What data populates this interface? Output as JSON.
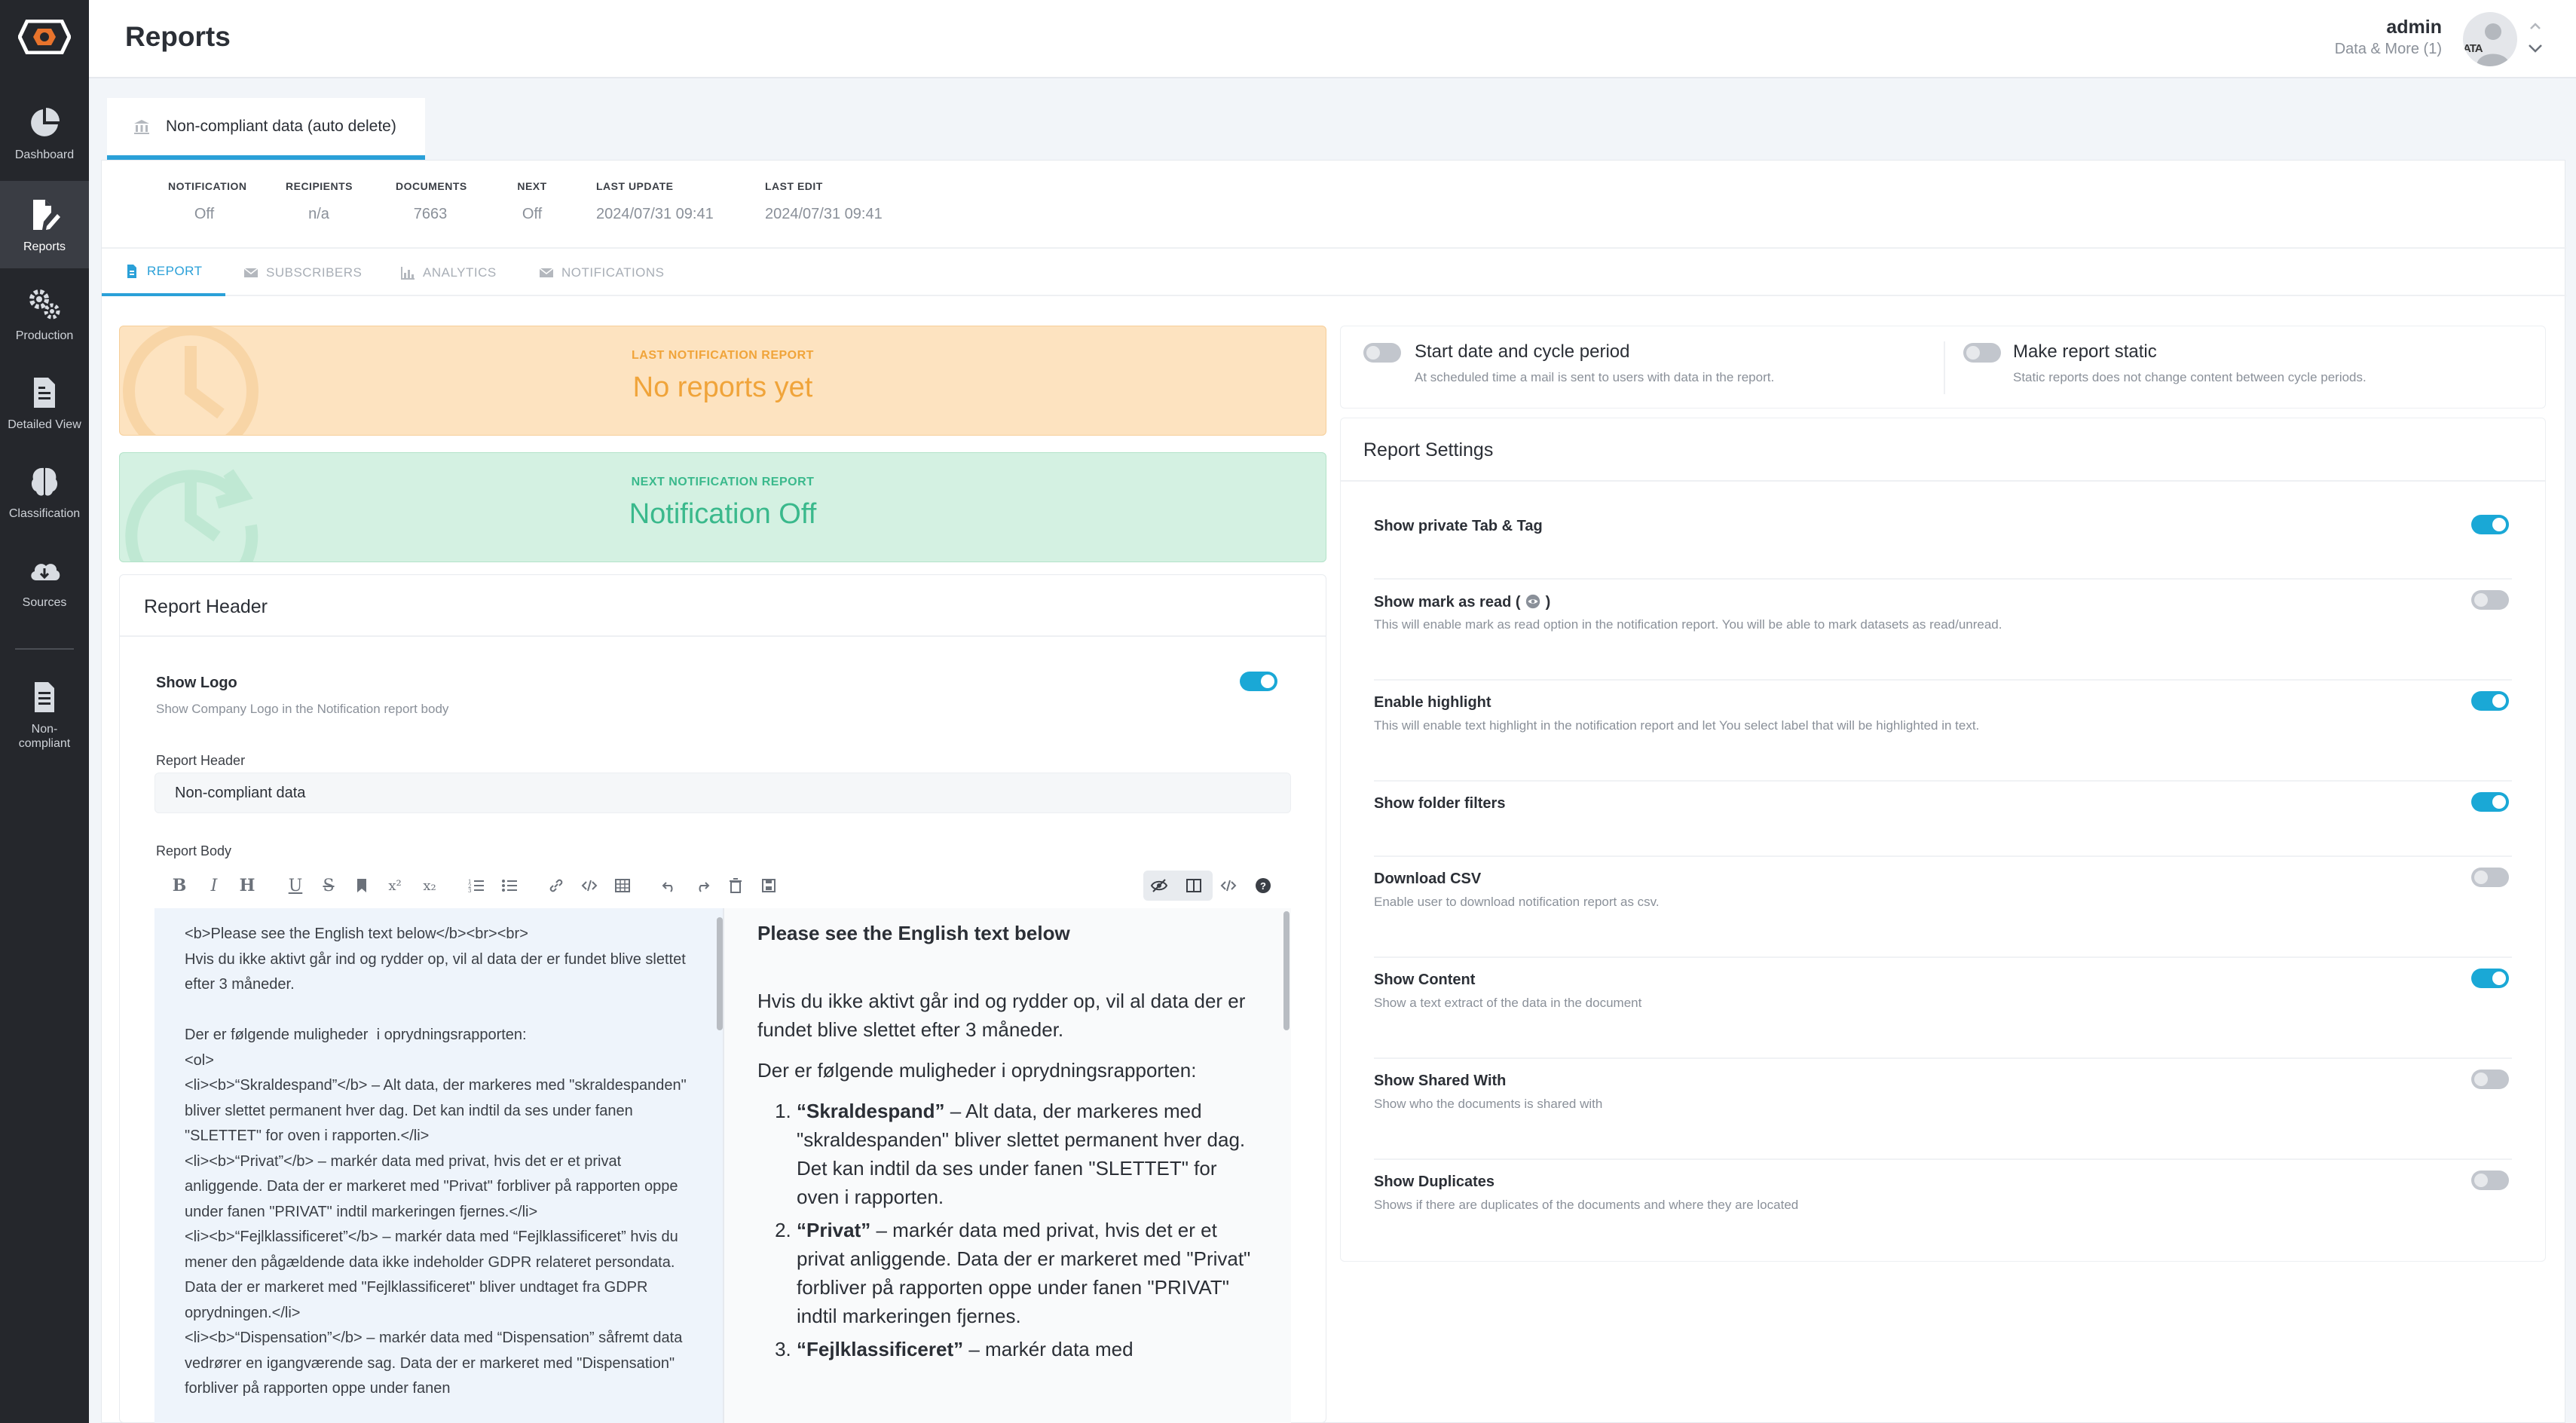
{
  "sidebar": {
    "items": [
      {
        "label": "Dashboard",
        "icon": "pie-chart-icon"
      },
      {
        "label": "Reports",
        "icon": "report-edit-icon"
      },
      {
        "label": "Production",
        "icon": "gears-icon"
      },
      {
        "label": "Detailed View",
        "icon": "document-icon"
      },
      {
        "label": "Classification",
        "icon": "brain-icon"
      },
      {
        "label": "Sources",
        "icon": "cloud-download-icon"
      },
      {
        "label": "Non-\ncompliant",
        "icon": "non-compliant-doc-icon"
      }
    ],
    "active": "Reports"
  },
  "header": {
    "title": "Reports",
    "user_name": "admin",
    "user_org": "Data & More (1)",
    "avatar_text": "ATA"
  },
  "report_tab": {
    "label": "Non-compliant data (auto delete)"
  },
  "stats": [
    {
      "label": "NOTIFICATION",
      "value": "Off"
    },
    {
      "label": "RECIPIENTS",
      "value": "n/a"
    },
    {
      "label": "DOCUMENTS",
      "value": "7663"
    },
    {
      "label": "NEXT",
      "value": "Off"
    },
    {
      "label": "LAST UPDATE",
      "value": "2024/07/31 09:41"
    },
    {
      "label": "LAST EDIT",
      "value": "2024/07/31 09:41"
    }
  ],
  "subtabs": [
    {
      "label": "REPORT",
      "active": true
    },
    {
      "label": "SUBSCRIBERS",
      "active": false
    },
    {
      "label": "ANALYTICS",
      "active": false
    },
    {
      "label": "NOTIFICATIONS",
      "active": false
    }
  ],
  "banners": {
    "last": {
      "label": "LAST NOTIFICATION REPORT",
      "value": "No reports yet"
    },
    "next": {
      "label": "NEXT NOTIFICATION REPORT",
      "value": "Notification Off"
    }
  },
  "report_header": {
    "title": "Report Header",
    "show_logo_label": "Show Logo",
    "show_logo_sub": "Show Company Logo in the Notification report body",
    "show_logo_on": true,
    "header_field_label": "Report Header",
    "header_value": "Non-compliant data",
    "body_field_label": "Report Body",
    "body_source": "<b>Please see the English text below</b><br><br>\nHvis du ikke aktivt går ind og rydder op, vil al data der er fundet blive slettet efter 3 måneder.\n\nDer er følgende muligheder  i oprydningsrapporten:\n<ol>\n<li><b>“Skraldespand”</b> – Alt data, der markeres med \"skraldespanden\" bliver slettet permanent hver dag. Det kan indtil da ses under fanen \"SLETTET\" for oven i rapporten.</li>\n<li><b>“Privat”</b> – markér data med privat, hvis det er et privat anliggende. Data der er markeret med \"Privat\" forbliver på rapporten oppe under fanen \"PRIVAT\" indtil markeringen fjernes.</li>\n<li><b>“Fejlklassificeret”</b> – markér data med “Fejlklassificeret” hvis du mener den pågældende data ikke indeholder GDPR relateret persondata. Data der er markeret med \"Fejlklassificeret\" bliver undtaget fra GDPR oprydningen.</li>\n<li><b>“Dispensation”</b> – markér data med “Dispensation” såfremt data vedrører en igangværende sag. Data der er markeret med \"Dispensation\" forbliver på rapporten oppe under fanen",
    "preview": {
      "heading": "Please see the English text below",
      "para1": "Hvis du ikke aktivt går ind og rydder op, vil al data der er fundet blive slettet efter 3 måneder.",
      "para2": "Der er følgende muligheder i oprydningsrapporten:",
      "items": [
        {
          "bold": "“Skraldespand”",
          "text": " – Alt data, der markeres med \"skraldespanden\" bliver slettet permanent hver dag. Det kan indtil da ses under fanen \"SLETTET\" for oven i rapporten."
        },
        {
          "bold": "“Privat”",
          "text": " – markér data med privat, hvis det er et privat anliggende. Data der er markeret med \"Privat\" forbliver på rapporten oppe under fanen \"PRIVAT\" indtil markeringen fjernes."
        },
        {
          "bold": "“Fejlklassificeret”",
          "text": " – markér data med"
        }
      ]
    }
  },
  "schedule": {
    "start_title": "Start date and cycle period",
    "start_sub": "At scheduled time a mail is sent to users with data in the report.",
    "start_on": false,
    "static_title": "Make report static",
    "static_sub": "Static reports does not change content between cycle periods.",
    "static_on": false
  },
  "report_settings": {
    "title": "Report Settings",
    "rows": [
      {
        "title": "Show private Tab & Tag",
        "sub": "",
        "on": true
      },
      {
        "title": "Show mark as read (",
        "title_suffix": " )",
        "sub": "This will enable mark as read option in the notification report. You will be able to mark datasets as read/unread.",
        "on": false
      },
      {
        "title": "Enable highlight",
        "sub": "This will enable text highlight in the notification report and let You select label that will be highlighted in text.",
        "on": true
      },
      {
        "title": "Show folder filters",
        "sub": "",
        "on": true
      },
      {
        "title": "Download CSV",
        "sub": "Enable user to download notification report as csv.",
        "on": false
      },
      {
        "title": "Show Content",
        "sub": "Show a text extract of the data in the document",
        "on": true
      },
      {
        "title": "Show Shared With",
        "sub": "Show who the documents is shared with",
        "on": false
      },
      {
        "title": "Show Duplicates",
        "sub": "Shows if there are duplicates of the documents and where they are located",
        "on": false
      }
    ]
  },
  "colors": {
    "accent": "#1aa8d6",
    "sidebar": "#25272c",
    "orange_banner": "#fde3c0",
    "green_banner": "#d4f1e2"
  }
}
